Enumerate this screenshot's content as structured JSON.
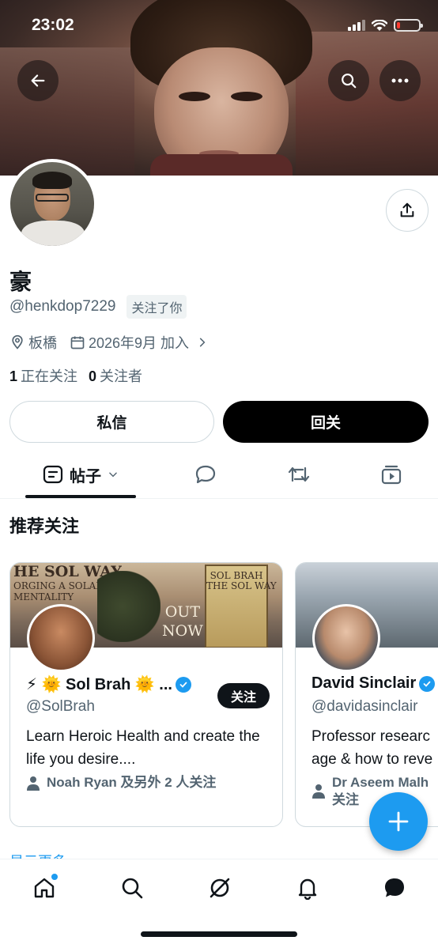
{
  "status_bar": {
    "time": "23:02",
    "battery_level": 0.1
  },
  "profile": {
    "name": "豪",
    "handle": "@henkdop7229",
    "follows_you_badge": "关注了你",
    "location": "板橋",
    "joined": "2026年9月 加入",
    "following_count": "1",
    "following_label": "正在关注",
    "followers_count": "0",
    "followers_label": "关注者"
  },
  "actions": {
    "dm_label": "私信",
    "follow_back_label": "回关"
  },
  "tabs": [
    {
      "label": "帖子",
      "icon": "posts-icon",
      "selected": true
    },
    {
      "label": "",
      "icon": "replies-icon"
    },
    {
      "label": "",
      "icon": "reposts-icon"
    },
    {
      "label": "",
      "icon": "media-icon"
    }
  ],
  "suggestions": {
    "title": "推荐关注",
    "cards": [
      {
        "banner_title": "HE SOL WAY",
        "banner_sub": "ORGING A SOLAR\nMENTALITY",
        "banner_out": "OUT\nNOW",
        "banner_book": "SOL BRAH\nTHE SOL WAY",
        "name": "⚡ 🌞 Sol Brah 🌞 ...",
        "handle": "@SolBrah",
        "bio": "Learn Heroic Health and create the life you desire....",
        "social": "Noah Ryan 及另外 2 人关注",
        "follow_label": "关注",
        "verified": true
      },
      {
        "name": "David Sinclair",
        "handle": "@davidasinclair",
        "bio_line1": "Professor researc",
        "bio_line2": "age & how to reve",
        "social_line1": "Dr Aseem Malh",
        "social_line2": "关注",
        "verified": true
      }
    ],
    "show_more": "显示更多"
  },
  "colors": {
    "accent": "#1d9bf0",
    "text": "#0f1419",
    "muted": "#536471",
    "border": "#cfd9de"
  },
  "bottom_nav": [
    "home-icon",
    "search-icon",
    "grok-icon",
    "notifications-icon",
    "messages-icon"
  ]
}
